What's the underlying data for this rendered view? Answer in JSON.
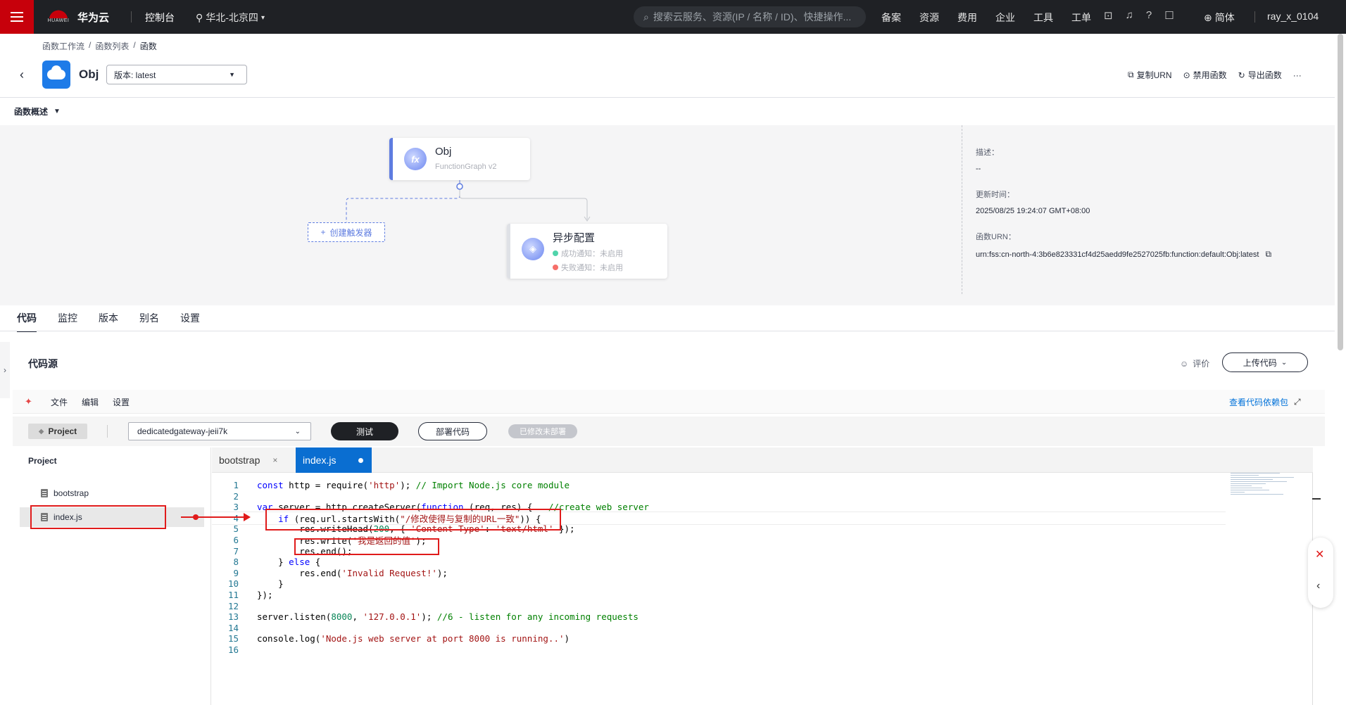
{
  "topbar": {
    "logo_text": "HUAWEI",
    "brand": "华为云",
    "console": "控制台",
    "region": "华北-北京四",
    "search_placeholder": "搜索云服务、资源(IP / 名称 / ID)、快捷操作...",
    "links": [
      "备案",
      "资源",
      "费用",
      "企业",
      "工具",
      "工单"
    ],
    "lang": "简体",
    "user": "ray_x_0104"
  },
  "breadcrumb": [
    "函数工作流",
    "函数列表",
    "函数"
  ],
  "function": {
    "name": "Obj",
    "version": "版本: latest"
  },
  "header_actions": {
    "copy_urn": "复制URN",
    "disable": "禁用函数",
    "export": "导出函数",
    "more": "···"
  },
  "overview": {
    "toggle_label": "函数概述",
    "node_obj": {
      "title": "Obj",
      "sub": "FunctionGraph v2"
    },
    "node_async": {
      "title": "异步配置",
      "success": "成功通知：未启用",
      "fail": "失败通知：未启用"
    },
    "trigger_button": "创建触发器",
    "desc_label": "描述：",
    "desc_value": "--",
    "updated_label": "更新时间：",
    "updated_value": "2025/08/25 19:24:07 GMT+08:00",
    "urn_label": "函数URN：",
    "urn_value": "urn:fss:cn-north-4:3b6e823331cf4d25aedd9fe2527025fb:function:default:Obj:latest"
  },
  "tabs": [
    "代码",
    "监控",
    "版本",
    "别名",
    "设置"
  ],
  "code_source": {
    "title": "代码源",
    "rate": "评价",
    "upload": "上传代码",
    "menu": [
      "文件",
      "编辑",
      "设置"
    ],
    "deps_link": "查看代码依赖包",
    "project_button": "Project",
    "gateway": "dedicatedgateway-jeii7k",
    "test": "测试",
    "deploy": "部署代码",
    "undeployed": "已修改未部署"
  },
  "explorer": {
    "title": "Project",
    "files": [
      "bootstrap",
      "index.js"
    ]
  },
  "editor_tabs": [
    "bootstrap",
    "index.js"
  ],
  "code_lines": [
    "const http = require('http'); // Import Node.js core module",
    "",
    "var server = http.createServer(function (req, res) {   //create web server",
    "    if (req.url.startsWith(\"/修改使得与复制的URL一致\")) {",
    "        res.writeHead(200, { 'Content-Type': 'text/html' });",
    "        res.write('我是返回的值');",
    "        res.end();",
    "    } else {",
    "        res.end('Invalid Request!');",
    "    }",
    "});",
    "",
    "server.listen(8000, '127.0.0.1'); //6 - listen for any incoming requests",
    "",
    "console.log('Node.js web server at port 8000 is running..')",
    ""
  ],
  "colors": {
    "brand_red": "#c7000b",
    "topbar_bg": "#1f2125",
    "active_tab_blue": "#0a6ed1",
    "annotation_red": "#e01b1b",
    "link_blue": "#0071d9"
  }
}
